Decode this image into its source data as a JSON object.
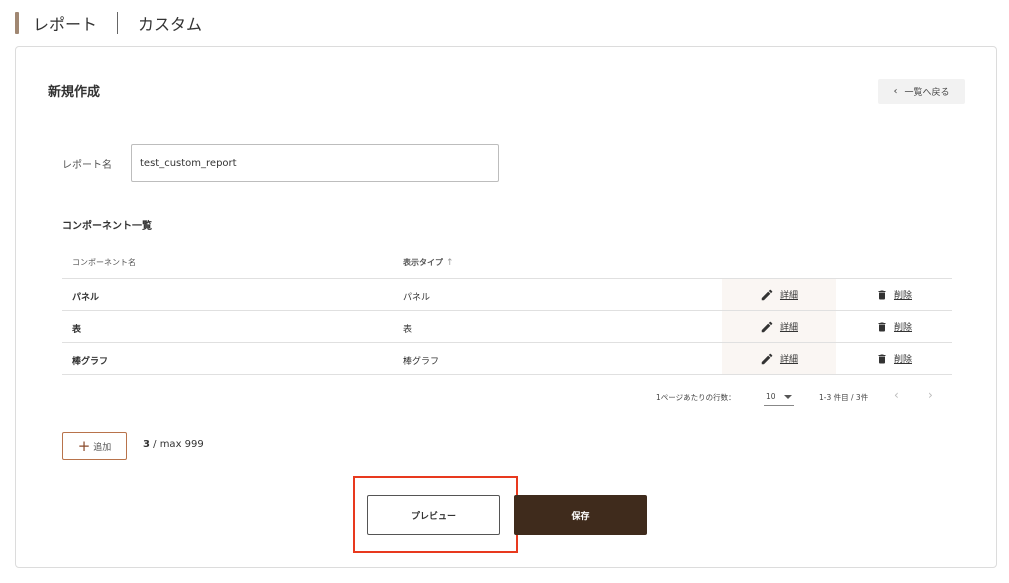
{
  "header": {
    "crumb_reports": "レポート",
    "crumb_custom": "カスタム"
  },
  "card": {
    "title": "新規作成",
    "back_label": "一覧へ戻る"
  },
  "report_name": {
    "label": "レポート名",
    "value": "test_custom_report"
  },
  "components": {
    "title": "コンポーネント一覧",
    "columns": {
      "name": "コンポーネント名",
      "type": "表示タイプ"
    },
    "rows": [
      {
        "name": "パネル",
        "type": "パネル",
        "detail": "詳細",
        "delete": "削除"
      },
      {
        "name": "表",
        "type": "表",
        "detail": "詳細",
        "delete": "削除"
      },
      {
        "name": "棒グラフ",
        "type": "棒グラフ",
        "detail": "詳細",
        "delete": "削除"
      }
    ]
  },
  "pagination": {
    "rows_label": "1ページあたりの行数：",
    "rows_value": "10",
    "range": "1-3 件目 / 3件"
  },
  "add": {
    "label": "追加",
    "count": "3",
    "max": " / max 999"
  },
  "actions": {
    "preview": "プレビュー",
    "save": "保存"
  },
  "colors": {
    "accent_bar": "#a08772",
    "save_bg": "#3f2b1c",
    "highlight": "#e8391e",
    "add_border": "#b8734b"
  }
}
